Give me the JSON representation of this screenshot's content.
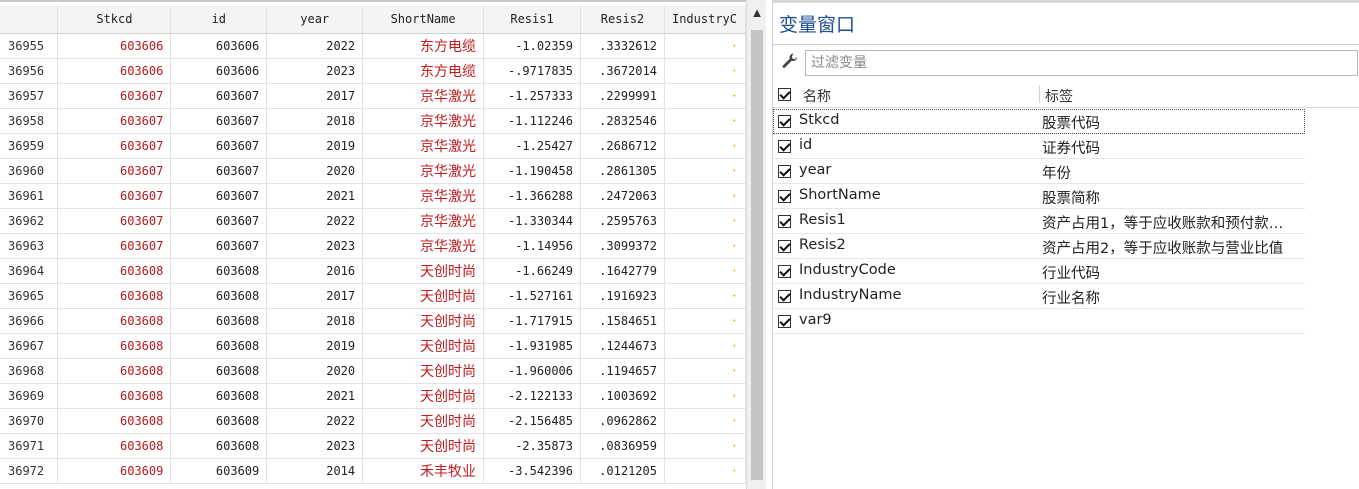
{
  "grid": {
    "columns": [
      "Stkcd",
      "id",
      "year",
      "ShortName",
      "Resis1",
      "Resis2",
      "IndustryC"
    ],
    "rows": [
      {
        "n": "36955",
        "stkcd": "603606",
        "id": "603606",
        "year": "2022",
        "name": "东方电缆",
        "r1": "-1.02359",
        "r2": ".3332612"
      },
      {
        "n": "36956",
        "stkcd": "603606",
        "id": "603606",
        "year": "2023",
        "name": "东方电缆",
        "r1": "-.9717835",
        "r2": ".3672014"
      },
      {
        "n": "36957",
        "stkcd": "603607",
        "id": "603607",
        "year": "2017",
        "name": "京华激光",
        "r1": "-1.257333",
        "r2": ".2299991"
      },
      {
        "n": "36958",
        "stkcd": "603607",
        "id": "603607",
        "year": "2018",
        "name": "京华激光",
        "r1": "-1.112246",
        "r2": ".2832546"
      },
      {
        "n": "36959",
        "stkcd": "603607",
        "id": "603607",
        "year": "2019",
        "name": "京华激光",
        "r1": "-1.25427",
        "r2": ".2686712"
      },
      {
        "n": "36960",
        "stkcd": "603607",
        "id": "603607",
        "year": "2020",
        "name": "京华激光",
        "r1": "-1.190458",
        "r2": ".2861305"
      },
      {
        "n": "36961",
        "stkcd": "603607",
        "id": "603607",
        "year": "2021",
        "name": "京华激光",
        "r1": "-1.366288",
        "r2": ".2472063"
      },
      {
        "n": "36962",
        "stkcd": "603607",
        "id": "603607",
        "year": "2022",
        "name": "京华激光",
        "r1": "-1.330344",
        "r2": ".2595763"
      },
      {
        "n": "36963",
        "stkcd": "603607",
        "id": "603607",
        "year": "2023",
        "name": "京华激光",
        "r1": "-1.14956",
        "r2": ".3099372"
      },
      {
        "n": "36964",
        "stkcd": "603608",
        "id": "603608",
        "year": "2016",
        "name": "天创时尚",
        "r1": "-1.66249",
        "r2": ".1642779"
      },
      {
        "n": "36965",
        "stkcd": "603608",
        "id": "603608",
        "year": "2017",
        "name": "天创时尚",
        "r1": "-1.527161",
        "r2": ".1916923"
      },
      {
        "n": "36966",
        "stkcd": "603608",
        "id": "603608",
        "year": "2018",
        "name": "天创时尚",
        "r1": "-1.717915",
        "r2": ".1584651"
      },
      {
        "n": "36967",
        "stkcd": "603608",
        "id": "603608",
        "year": "2019",
        "name": "天创时尚",
        "r1": "-1.931985",
        "r2": ".1244673"
      },
      {
        "n": "36968",
        "stkcd": "603608",
        "id": "603608",
        "year": "2020",
        "name": "天创时尚",
        "r1": "-1.960006",
        "r2": ".1194657"
      },
      {
        "n": "36969",
        "stkcd": "603608",
        "id": "603608",
        "year": "2021",
        "name": "天创时尚",
        "r1": "-2.122133",
        "r2": ".1003692"
      },
      {
        "n": "36970",
        "stkcd": "603608",
        "id": "603608",
        "year": "2022",
        "name": "天创时尚",
        "r1": "-2.156485",
        "r2": ".0962862"
      },
      {
        "n": "36971",
        "stkcd": "603608",
        "id": "603608",
        "year": "2023",
        "name": "天创时尚",
        "r1": "-2.35873",
        "r2": ".0836959"
      },
      {
        "n": "36972",
        "stkcd": "603609",
        "id": "603609",
        "year": "2014",
        "name": "禾丰牧业",
        "r1": "-3.542396",
        "r2": ".0121205"
      }
    ]
  },
  "varpane": {
    "title": "变量窗口",
    "filter_placeholder": "过滤变量",
    "col_name": "名称",
    "col_label": "标签",
    "vars": [
      {
        "name": "Stkcd",
        "label": "股票代码"
      },
      {
        "name": "id",
        "label": "证券代码"
      },
      {
        "name": "year",
        "label": "年份"
      },
      {
        "name": "ShortName",
        "label": "股票简称"
      },
      {
        "name": "Resis1",
        "label": "资产占用1，等于应收账款和预付款…"
      },
      {
        "name": "Resis2",
        "label": "资产占用2，等于应收账款与营业比值"
      },
      {
        "name": "IndustryCode",
        "label": "行业代码"
      },
      {
        "name": "IndustryName",
        "label": "行业名称"
      },
      {
        "name": "var9",
        "label": ""
      }
    ]
  },
  "colors": {
    "accent_title": "#1f4e99",
    "cell_red": "#b4181c",
    "industry_yellow": "#e0a800"
  }
}
